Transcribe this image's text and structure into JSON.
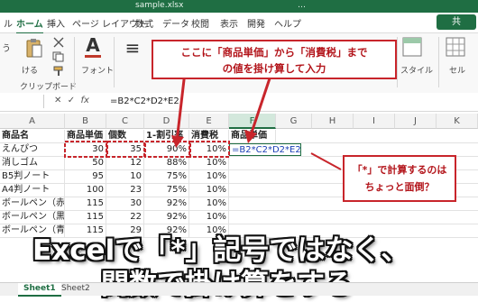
{
  "titlebar": {
    "filename": "sample.xlsx",
    "right_text": "…"
  },
  "ribbon_tabs": [
    "ル",
    "ホーム",
    "挿入",
    "ページ レイアウト",
    "数式",
    "データ",
    "校閲",
    "表示",
    "開発",
    "ヘルプ"
  ],
  "share_label": "共",
  "ribbon": {
    "paste_label": "ける",
    "clipboard_label": "クリップボード",
    "font_label": "フォント",
    "styles_label": "スタイル",
    "cells_label": "セル",
    "font_glyph": "A",
    "alignment_glyph": "≡",
    "number_glyph": "%",
    "row_label": "う"
  },
  "formula_bar": {
    "formula": "=B2*C2*D2*E2",
    "fx": "fx"
  },
  "columns": [
    "A",
    "B",
    "C",
    "D",
    "E",
    "F",
    "G",
    "H",
    "I",
    "J",
    "K"
  ],
  "table": {
    "headers": [
      "商品名",
      "商品単価",
      "個数",
      "1-割引率",
      "消費税",
      "商品単価"
    ],
    "rows": [
      [
        "えんぴつ",
        "30",
        "35",
        "90%",
        "10%",
        "=B2*C2*D2*E2"
      ],
      [
        "消しゴム",
        "50",
        "12",
        "88%",
        "10%",
        ""
      ],
      [
        "B5判ノート",
        "95",
        "10",
        "75%",
        "10%",
        ""
      ],
      [
        "A4判ノート",
        "100",
        "23",
        "75%",
        "10%",
        ""
      ],
      [
        "ボールペン（赤）",
        "115",
        "30",
        "92%",
        "10%",
        ""
      ],
      [
        "ボールペン（黒）",
        "115",
        "22",
        "92%",
        "10%",
        ""
      ],
      [
        "ボールペン（青）",
        "115",
        "29",
        "92%",
        "10%",
        ""
      ]
    ]
  },
  "sheets": [
    "Sheet1",
    "Sheet2"
  ],
  "callouts": {
    "top": [
      "ここに「商品単価」から「消費税」まで",
      "の値を掛け算して入力"
    ],
    "right": [
      "「*」で計算するのは",
      "ちょっと面倒？"
    ]
  },
  "banner": {
    "line1": "Excelで「*」記号ではなく、",
    "line2": "関数で掛け算をする"
  },
  "colors": {
    "excel_green": "#1f6e43",
    "callout_red": "#c8252b"
  }
}
